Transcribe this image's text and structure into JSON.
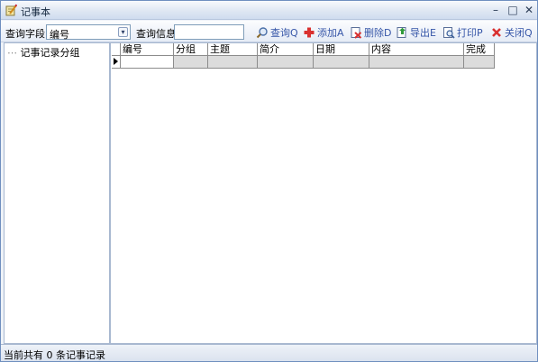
{
  "window": {
    "title": "记事本",
    "controls": [
      "minimize",
      "maximize",
      "close"
    ]
  },
  "toolbar": {
    "field_label": "查询字段",
    "field_value": "编号",
    "info_label": "查询信息",
    "search_value": "",
    "buttons": {
      "query": "查询Q",
      "add": "添加A",
      "delete": "删除D",
      "export": "导出E",
      "print": "打印P",
      "close": "关闭Q"
    }
  },
  "tree": {
    "root_label": "记事记录分组"
  },
  "grid": {
    "columns": [
      "编号",
      "分组",
      "主题",
      "简介",
      "日期",
      "内容",
      "完成"
    ],
    "rows": [
      [
        "",
        "",
        "",
        "",
        "",
        "",
        ""
      ]
    ]
  },
  "status": {
    "text": "当前共有 0 条记事记录"
  }
}
